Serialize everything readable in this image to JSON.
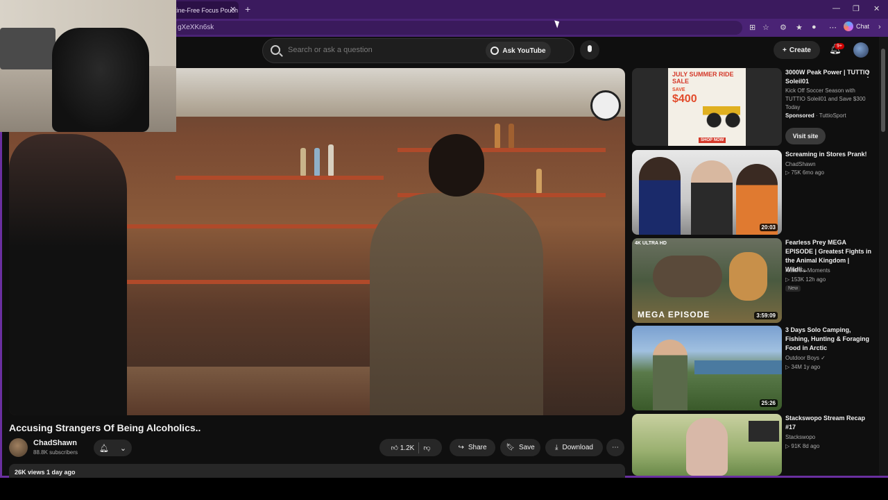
{
  "browser": {
    "tab_title": "tine-Free Focus Pouch",
    "url": "gXeXKn6sk",
    "chat_label": "Chat",
    "badge_count": "9+"
  },
  "header": {
    "search_placeholder": "Search or ask a question",
    "ask_label": "Ask YouTube",
    "create_label": "Create"
  },
  "video": {
    "title": "Accusing Strangers Of Being Alcoholics..",
    "channel": "ChadShawn",
    "subscribers": "88.8K subscribers",
    "likes": "1.2K",
    "share_label": "Share",
    "save_label": "Save",
    "download_label": "Download",
    "views_date": "26K views  1 day ago"
  },
  "sidebar": {
    "ad": {
      "title": "3000W Peak Power | TUTTIO Soleil01",
      "desc": "Kick Off Soccer Season with TUTTIO Soleil01 and Save $300 Today",
      "sponsored": "Sponsored",
      "advertiser": "· TuttioSport",
      "visit_label": "Visit site",
      "thumb_headline": "JULY SUMMER RIDE SALE",
      "thumb_save": "SAVE",
      "thumb_amount": "$400",
      "thumb_cta": "SHOP NOW"
    },
    "items": [
      {
        "title": "Screaming in Stores Prank!",
        "channel": "ChadShawn",
        "meta": "▷ 75K  6mo ago",
        "duration": "20:03",
        "badge": ""
      },
      {
        "title": "Fearless Prey MEGA EPISODE | Greatest Fights in the Animal Kingdom | Wildli...",
        "channel": "Nature's Moments",
        "meta": "▷ 153K  12h ago",
        "duration": "3:59:09",
        "badge": "New",
        "thumb_label": "MEGA EPISODE",
        "thumb_tag": "4K ULTRA HD"
      },
      {
        "title": "3 Days Solo Camping, Fishing, Hunting & Foraging Food in Arctic",
        "channel": "Outdoor Boys ✓",
        "meta": "▷ 34M  1y ago",
        "duration": "25:26",
        "badge": ""
      },
      {
        "title": "Stackswopo Stream Recap #17",
        "channel": "Stackswopo",
        "meta": "▷ 91K  8d ago",
        "duration": "",
        "badge": ""
      }
    ]
  }
}
